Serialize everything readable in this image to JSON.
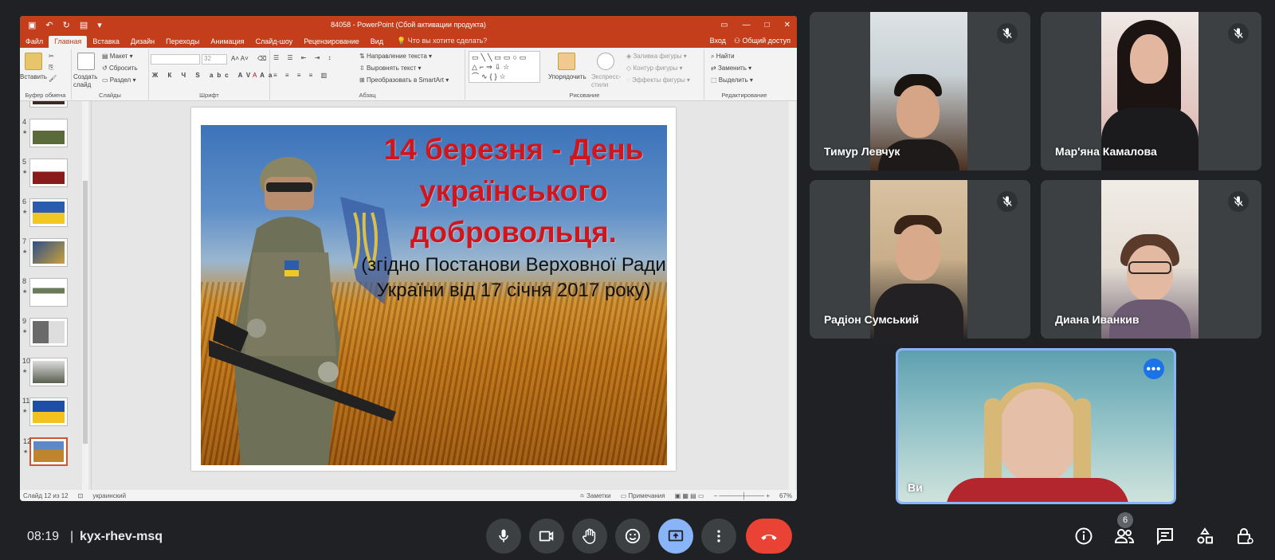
{
  "powerpoint": {
    "doc_title": "84058 - PowerPoint (Сбой активации продукта)",
    "tabs": [
      "Файл",
      "Главная",
      "Вставка",
      "Дизайн",
      "Переходы",
      "Анимация",
      "Слайд-шоу",
      "Рецензирование",
      "Вид"
    ],
    "active_tab": "Главная",
    "tell_me": "Что вы хотите сделать?",
    "sign_in": "Вход",
    "share": "Общий доступ",
    "ribbon": {
      "clipboard_paste": "Вставить",
      "clipboard_label": "Буфер обмена",
      "new_slide": "Создать слайд",
      "layout": "Макет",
      "reset": "Сбросить",
      "section": "Раздел",
      "slides_label": "Слайды",
      "font_size": "32",
      "font_label": "Шрифт",
      "text_direction": "Направление текста",
      "align_text": "Выровнять текст",
      "smartart": "Преобразовать в SmartArt",
      "paragraph_label": "Абзац",
      "arrange": "Упорядочить",
      "quick_styles": "Экспресс-стили",
      "shape_fill": "Заливка фигуры",
      "shape_outline": "Контур фигуры",
      "shape_effects": "Эффекты фигуры",
      "drawing_label": "Рисование",
      "find": "Найти",
      "replace": "Заменить",
      "select": "Выделить",
      "editing_label": "Редактирование"
    },
    "thumbnails": [
      {
        "num": "4",
        "star": "★"
      },
      {
        "num": "5",
        "star": "★"
      },
      {
        "num": "6",
        "star": "★"
      },
      {
        "num": "7",
        "star": "★"
      },
      {
        "num": "8",
        "star": "★"
      },
      {
        "num": "9",
        "star": "★"
      },
      {
        "num": "10",
        "star": "★"
      },
      {
        "num": "11",
        "star": "★"
      },
      {
        "num": "12",
        "star": "★"
      }
    ],
    "slide": {
      "title_line1": "14 березня - День",
      "title_line2": "українського",
      "title_line3": "добровольця.",
      "sub_line1": "(згідно Постанови Верховної Ради",
      "sub_line2": "України від 17 січня 2017 року)"
    },
    "status": {
      "slide_count": "Слайд 12 из 12",
      "language": "украинский",
      "notes": "Заметки",
      "comments": "Примечания",
      "zoom": "67%"
    }
  },
  "participants": [
    {
      "name": "Тимур Левчук",
      "muted": true
    },
    {
      "name": "Мар'яна Камалова",
      "muted": true
    },
    {
      "name": "Радіон Сумський",
      "muted": true
    },
    {
      "name": "Диана Иванкив",
      "muted": true
    }
  ],
  "self_tile": {
    "name": "Ви"
  },
  "meeting": {
    "time": "08:19",
    "separator": "|",
    "code": "kyx-rhev-msq",
    "participant_count": "6"
  },
  "colors": {
    "ppt_accent": "#c43e1c",
    "meet_bg": "#202124",
    "tile_bg": "#3c4043",
    "present_active": "#8ab4f8",
    "end_call": "#ea4335",
    "slide_title_red": "#d0161c"
  },
  "icons": {
    "mic": "mic-icon",
    "camera": "camera-icon",
    "hand": "raise-hand-icon",
    "emoji": "emoji-icon",
    "present": "present-screen-icon",
    "more": "more-vert-icon",
    "end": "end-call-icon",
    "info": "info-icon",
    "people": "people-icon",
    "chat": "chat-icon",
    "activities": "activities-icon",
    "lock": "host-controls-icon"
  }
}
